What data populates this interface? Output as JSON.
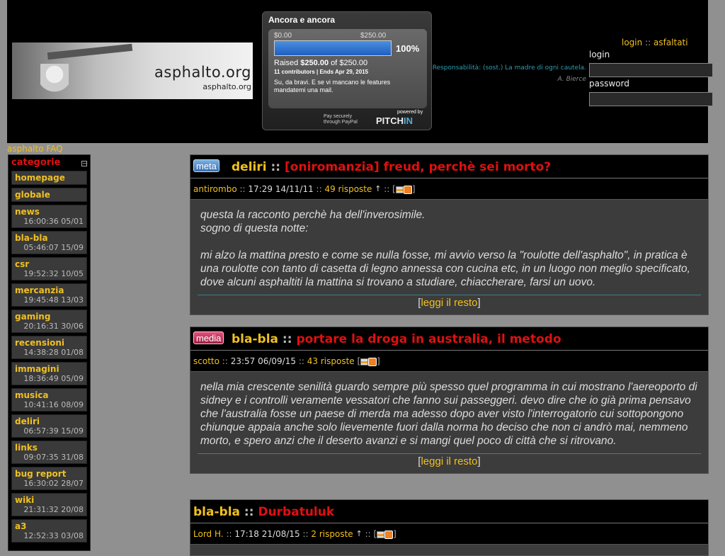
{
  "header": {
    "logo_text": "asphalto.org",
    "logo_subtext": "asphalto.org",
    "widget": {
      "title": "Ancora e ancora",
      "low": "$0.00",
      "high": "$250.00",
      "progress": 1.0,
      "percent": "100%",
      "raised_prefix": "Raised ",
      "raised_amount": "$250.00",
      "raised_suffix": " of $250.00",
      "meta": "11 contributors | Ends Apr 29, 2015",
      "message": "Su, da bravi. E se vi mancano le features mandatemi una mail.",
      "paypal_line1": "Pay securely",
      "paypal_line2": "through PayPal",
      "powered": "powered by",
      "brand_a": "PITCH",
      "brand_b": "IN"
    },
    "quote": {
      "text": "Responsabilità: (sost.) La madre di ogni cautela.",
      "author": "A. Bierce"
    },
    "login_link": "login",
    "login_sep": "::",
    "asfaltati_link": "asfaltati",
    "login_label": "login",
    "password_label": "password",
    "login_value": "",
    "password_value": ""
  },
  "faq_link": "asphalto FAQ",
  "sidebar": {
    "title": "categorie",
    "toggle": "−",
    "items": [
      {
        "name": "homepage",
        "time": ""
      },
      {
        "name": "globale",
        "time": ""
      },
      {
        "name": "news",
        "time": "16:00:36 05/01"
      },
      {
        "name": "bla-bla",
        "time": "05:46:07 15/09"
      },
      {
        "name": "csr",
        "time": "19:52:32 10/05"
      },
      {
        "name": "mercanzia",
        "time": "19:45:48 13/03"
      },
      {
        "name": "gaming",
        "time": "20:16:31 30/06"
      },
      {
        "name": "recensioni",
        "time": "14:38:28 01/08"
      },
      {
        "name": "immagini",
        "time": "18:36:49 05/09"
      },
      {
        "name": "musica",
        "time": "10:41:16 08/09"
      },
      {
        "name": "deliri",
        "time": "06:57:39 15/09"
      },
      {
        "name": "links",
        "time": "09:07:35 31/08"
      },
      {
        "name": "bug report",
        "time": "16:30:02 28/07"
      },
      {
        "name": "wiki",
        "time": "21:31:32 20/08"
      },
      {
        "name": "a3",
        "time": "12:52:33 03/08"
      }
    ]
  },
  "posts": [
    {
      "badge": "meta",
      "category": "deliri",
      "sep": "::",
      "title": "[oniromanzia] freud, perchè sei morto?",
      "author": "antirombo",
      "meta_sep": "::",
      "datetime": "17:29 14/11/11",
      "replies": "49 risposte",
      "up": "↑",
      "tools_open": ":: [",
      "tools_close": "]",
      "body": [
        "questa la racconto perchè ha dell'inverosimile.",
        "sogno di questa notte:",
        "",
        "mi alzo la mattina presto e come se nulla fosse, mi avvio verso la \"roulotte dell'asphalto\", in pratica è una roulotte con tanto di casetta di legno annessa con cucina etc, in un luogo non meglio specificato, dove alcuni asphaltiti la mattina si trovano a studiare, chiaccherare, farsi un uovo."
      ],
      "more_open": "[",
      "more": "leggi il resto",
      "more_close": "]"
    },
    {
      "badge": "media",
      "category": "bla-bla",
      "sep": "::",
      "title": "portare la droga in australia, il metodo",
      "author": "scotto",
      "meta_sep": "::",
      "datetime": "23:57 06/09/15",
      "replies": "43 risposte",
      "tools_open": "[",
      "tools_close": "]",
      "body": [
        "nella mia crescente senilità guardo sempre più spesso quel programma in cui mostrano l'aereoporto di sidney e i controlli veramente vessatori che fanno sui passeggeri. devo dire che io già prima pensavo che l'australia fosse un paese di merda ma adesso dopo aver visto l'interrogatorio cui sottopongono chiunque appaia anche solo lievemente fuori dalla norma ho deciso che non ci andrò mai, nemmeno morto, e spero anzi che il deserto avanzi e si mangi quel poco di città che si ritrovano."
      ],
      "more_open": "[",
      "more": "leggi il resto",
      "more_close": "]"
    },
    {
      "category": "bla-bla",
      "sep": "::",
      "title": "Durbatuluk",
      "author": "Lord H.",
      "meta_sep": "::",
      "datetime": "17:18 21/08/15",
      "replies": "2 risposte",
      "up": "↑",
      "tools_open": ":: [",
      "tools_close": "]"
    }
  ]
}
